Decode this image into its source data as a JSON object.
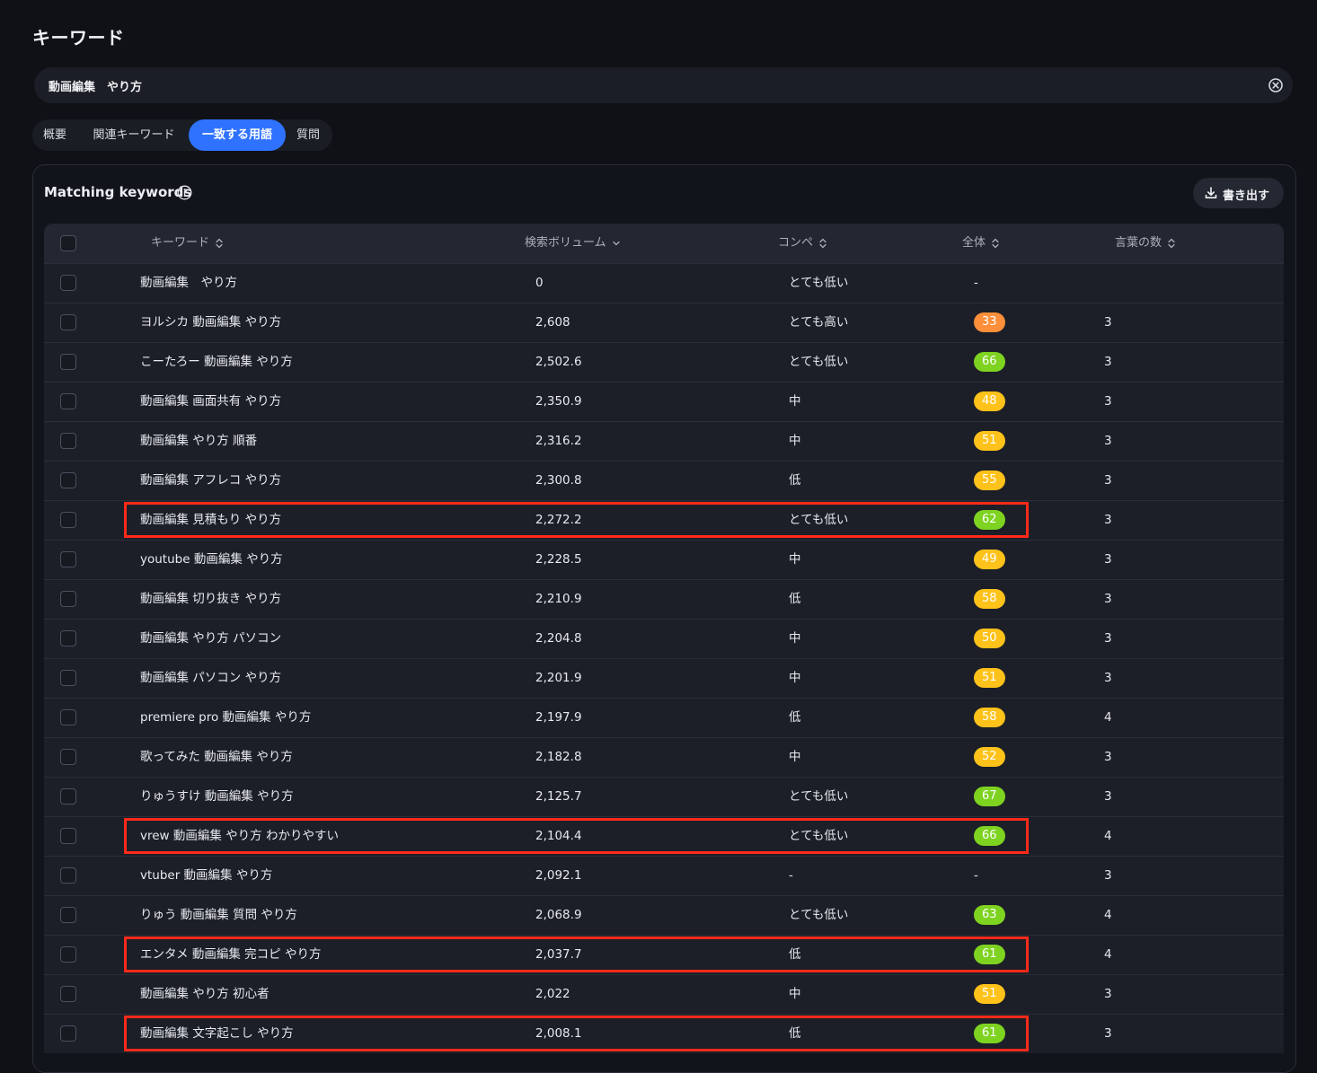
{
  "page": {
    "title": "キーワード"
  },
  "search": {
    "value": "動画編集　やり方"
  },
  "tabs": [
    {
      "label": "概要",
      "active": false
    },
    {
      "label": "関連キーワード",
      "active": false
    },
    {
      "label": "一致する用語",
      "active": true
    },
    {
      "label": "質問",
      "active": false
    }
  ],
  "card": {
    "title": "Matching keywords",
    "export_label": "書き出す"
  },
  "table": {
    "headers": {
      "keyword": "キーワード",
      "volume": "検索ボリューム",
      "competition": "コンペ",
      "overall": "全体",
      "word_count": "言葉の数"
    },
    "rows": [
      {
        "keyword": "動画編集　やり方",
        "volume": "0",
        "competition": "とても低い",
        "overall": "-",
        "word_count": "",
        "highlighted": false
      },
      {
        "keyword": "ヨルシカ 動画編集 やり方",
        "volume": "2,608",
        "competition": "とても高い",
        "overall": "33",
        "word_count": "3",
        "highlighted": false
      },
      {
        "keyword": "こーたろー 動画編集 やり方",
        "volume": "2,502.6",
        "competition": "とても低い",
        "overall": "66",
        "word_count": "3",
        "highlighted": false
      },
      {
        "keyword": "動画編集 画面共有 やり方",
        "volume": "2,350.9",
        "competition": "中",
        "overall": "48",
        "word_count": "3",
        "highlighted": false
      },
      {
        "keyword": "動画編集 やり方 順番",
        "volume": "2,316.2",
        "competition": "中",
        "overall": "51",
        "word_count": "3",
        "highlighted": false
      },
      {
        "keyword": "動画編集 アフレコ やり方",
        "volume": "2,300.8",
        "competition": "低",
        "overall": "55",
        "word_count": "3",
        "highlighted": false
      },
      {
        "keyword": "動画編集 見積もり やり方",
        "volume": "2,272.2",
        "competition": "とても低い",
        "overall": "62",
        "word_count": "3",
        "highlighted": true
      },
      {
        "keyword": "youtube 動画編集 やり方",
        "volume": "2,228.5",
        "competition": "中",
        "overall": "49",
        "word_count": "3",
        "highlighted": false
      },
      {
        "keyword": "動画編集 切り抜き やり方",
        "volume": "2,210.9",
        "competition": "低",
        "overall": "58",
        "word_count": "3",
        "highlighted": false
      },
      {
        "keyword": "動画編集 やり方 パソコン",
        "volume": "2,204.8",
        "competition": "中",
        "overall": "50",
        "word_count": "3",
        "highlighted": false
      },
      {
        "keyword": "動画編集 パソコン やり方",
        "volume": "2,201.9",
        "competition": "中",
        "overall": "51",
        "word_count": "3",
        "highlighted": false
      },
      {
        "keyword": "premiere pro 動画編集 やり方",
        "volume": "2,197.9",
        "competition": "低",
        "overall": "58",
        "word_count": "4",
        "highlighted": false
      },
      {
        "keyword": "歌ってみた 動画編集 やり方",
        "volume": "2,182.8",
        "competition": "中",
        "overall": "52",
        "word_count": "3",
        "highlighted": false
      },
      {
        "keyword": "りゅうすけ 動画編集 やり方",
        "volume": "2,125.7",
        "competition": "とても低い",
        "overall": "67",
        "word_count": "3",
        "highlighted": false
      },
      {
        "keyword": "vrew 動画編集 やり方 わかりやすい",
        "volume": "2,104.4",
        "competition": "とても低い",
        "overall": "66",
        "word_count": "4",
        "highlighted": true
      },
      {
        "keyword": "vtuber 動画編集 やり方",
        "volume": "2,092.1",
        "competition": "-",
        "overall": "-",
        "word_count": "3",
        "highlighted": false
      },
      {
        "keyword": "りゅう 動画編集 質問 やり方",
        "volume": "2,068.9",
        "competition": "とても低い",
        "overall": "63",
        "word_count": "4",
        "highlighted": false
      },
      {
        "keyword": "エンタメ 動画編集 完コピ やり方",
        "volume": "2,037.7",
        "competition": "低",
        "overall": "61",
        "word_count": "4",
        "highlighted": true
      },
      {
        "keyword": "動画編集 やり方 初心者",
        "volume": "2,022",
        "competition": "中",
        "overall": "51",
        "word_count": "3",
        "highlighted": false
      },
      {
        "keyword": "動画編集 文字起こし やり方",
        "volume": "2,008.1",
        "competition": "低",
        "overall": "61",
        "word_count": "3",
        "highlighted": true
      }
    ]
  },
  "colors": {
    "accent": "#2f72ff",
    "badge_green": "#7ed321",
    "badge_yellow": "#ffc21a",
    "badge_orange": "#ff8f3a",
    "highlight": "#ff2a1a"
  },
  "icons": {
    "clear": "close-circle-icon",
    "info": "info-icon",
    "export": "download-icon",
    "sort": "sort-icon",
    "sort_desc": "chevron-down-icon"
  }
}
